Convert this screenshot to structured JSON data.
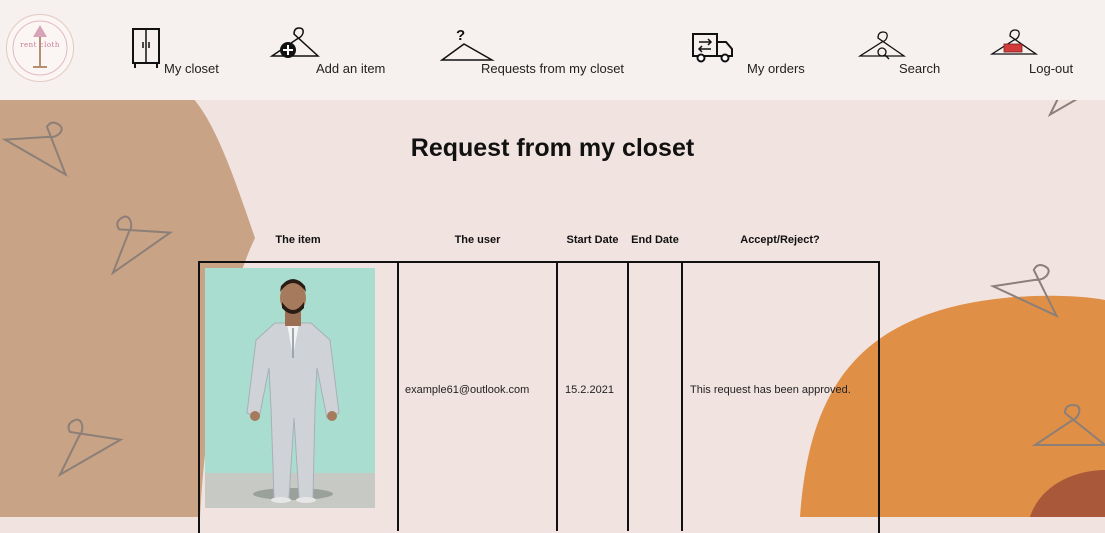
{
  "app": {
    "logo_text": "rent cloth"
  },
  "nav": {
    "my_closet": "My closet",
    "add_item": "Add an item",
    "requests": "Requests from my closet",
    "my_orders": "My orders",
    "search": "Search",
    "logout": "Log-out"
  },
  "page": {
    "title": "Request from my closet"
  },
  "table": {
    "headers": [
      "The item",
      "The user",
      "Start Date",
      "End Date",
      "Accept/Reject?"
    ],
    "rows": [
      {
        "user": "example61@outlook.com",
        "start_date": "15.2.2021",
        "end_date": "",
        "status": "This request has been approved."
      }
    ]
  },
  "colors": {
    "page_bg": "#f1e3e0",
    "nav_bg": "#f6f0ee",
    "tan_shape": "#c9a386",
    "orange_shape": "#e08f47",
    "photo_bg": "#a9ddd0"
  }
}
